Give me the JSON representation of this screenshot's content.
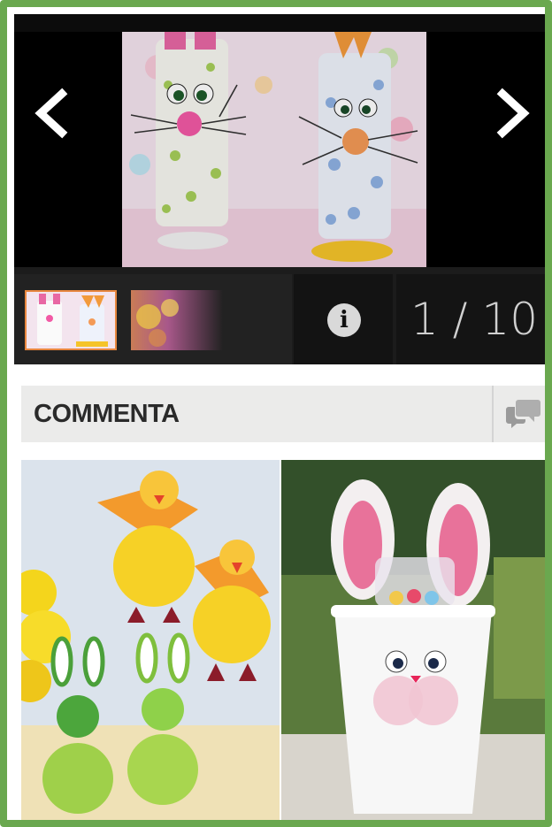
{
  "gallery": {
    "prev_icon": "chevron-left-icon",
    "next_icon": "chevron-right-icon",
    "main_image_alt": "",
    "counter": "1 / 10",
    "info_icon": "info-icon",
    "info_label": "i"
  },
  "thumbnails": [
    {
      "selected": true
    },
    {
      "selected": false
    }
  ],
  "comments": {
    "title": "COMMENTA",
    "icon": "chat-bubbles-icon"
  },
  "colors": {
    "frame": "#6aa84f",
    "thumb_selected_border": "#e8873f",
    "comment_bar_bg": "#ebebea"
  }
}
